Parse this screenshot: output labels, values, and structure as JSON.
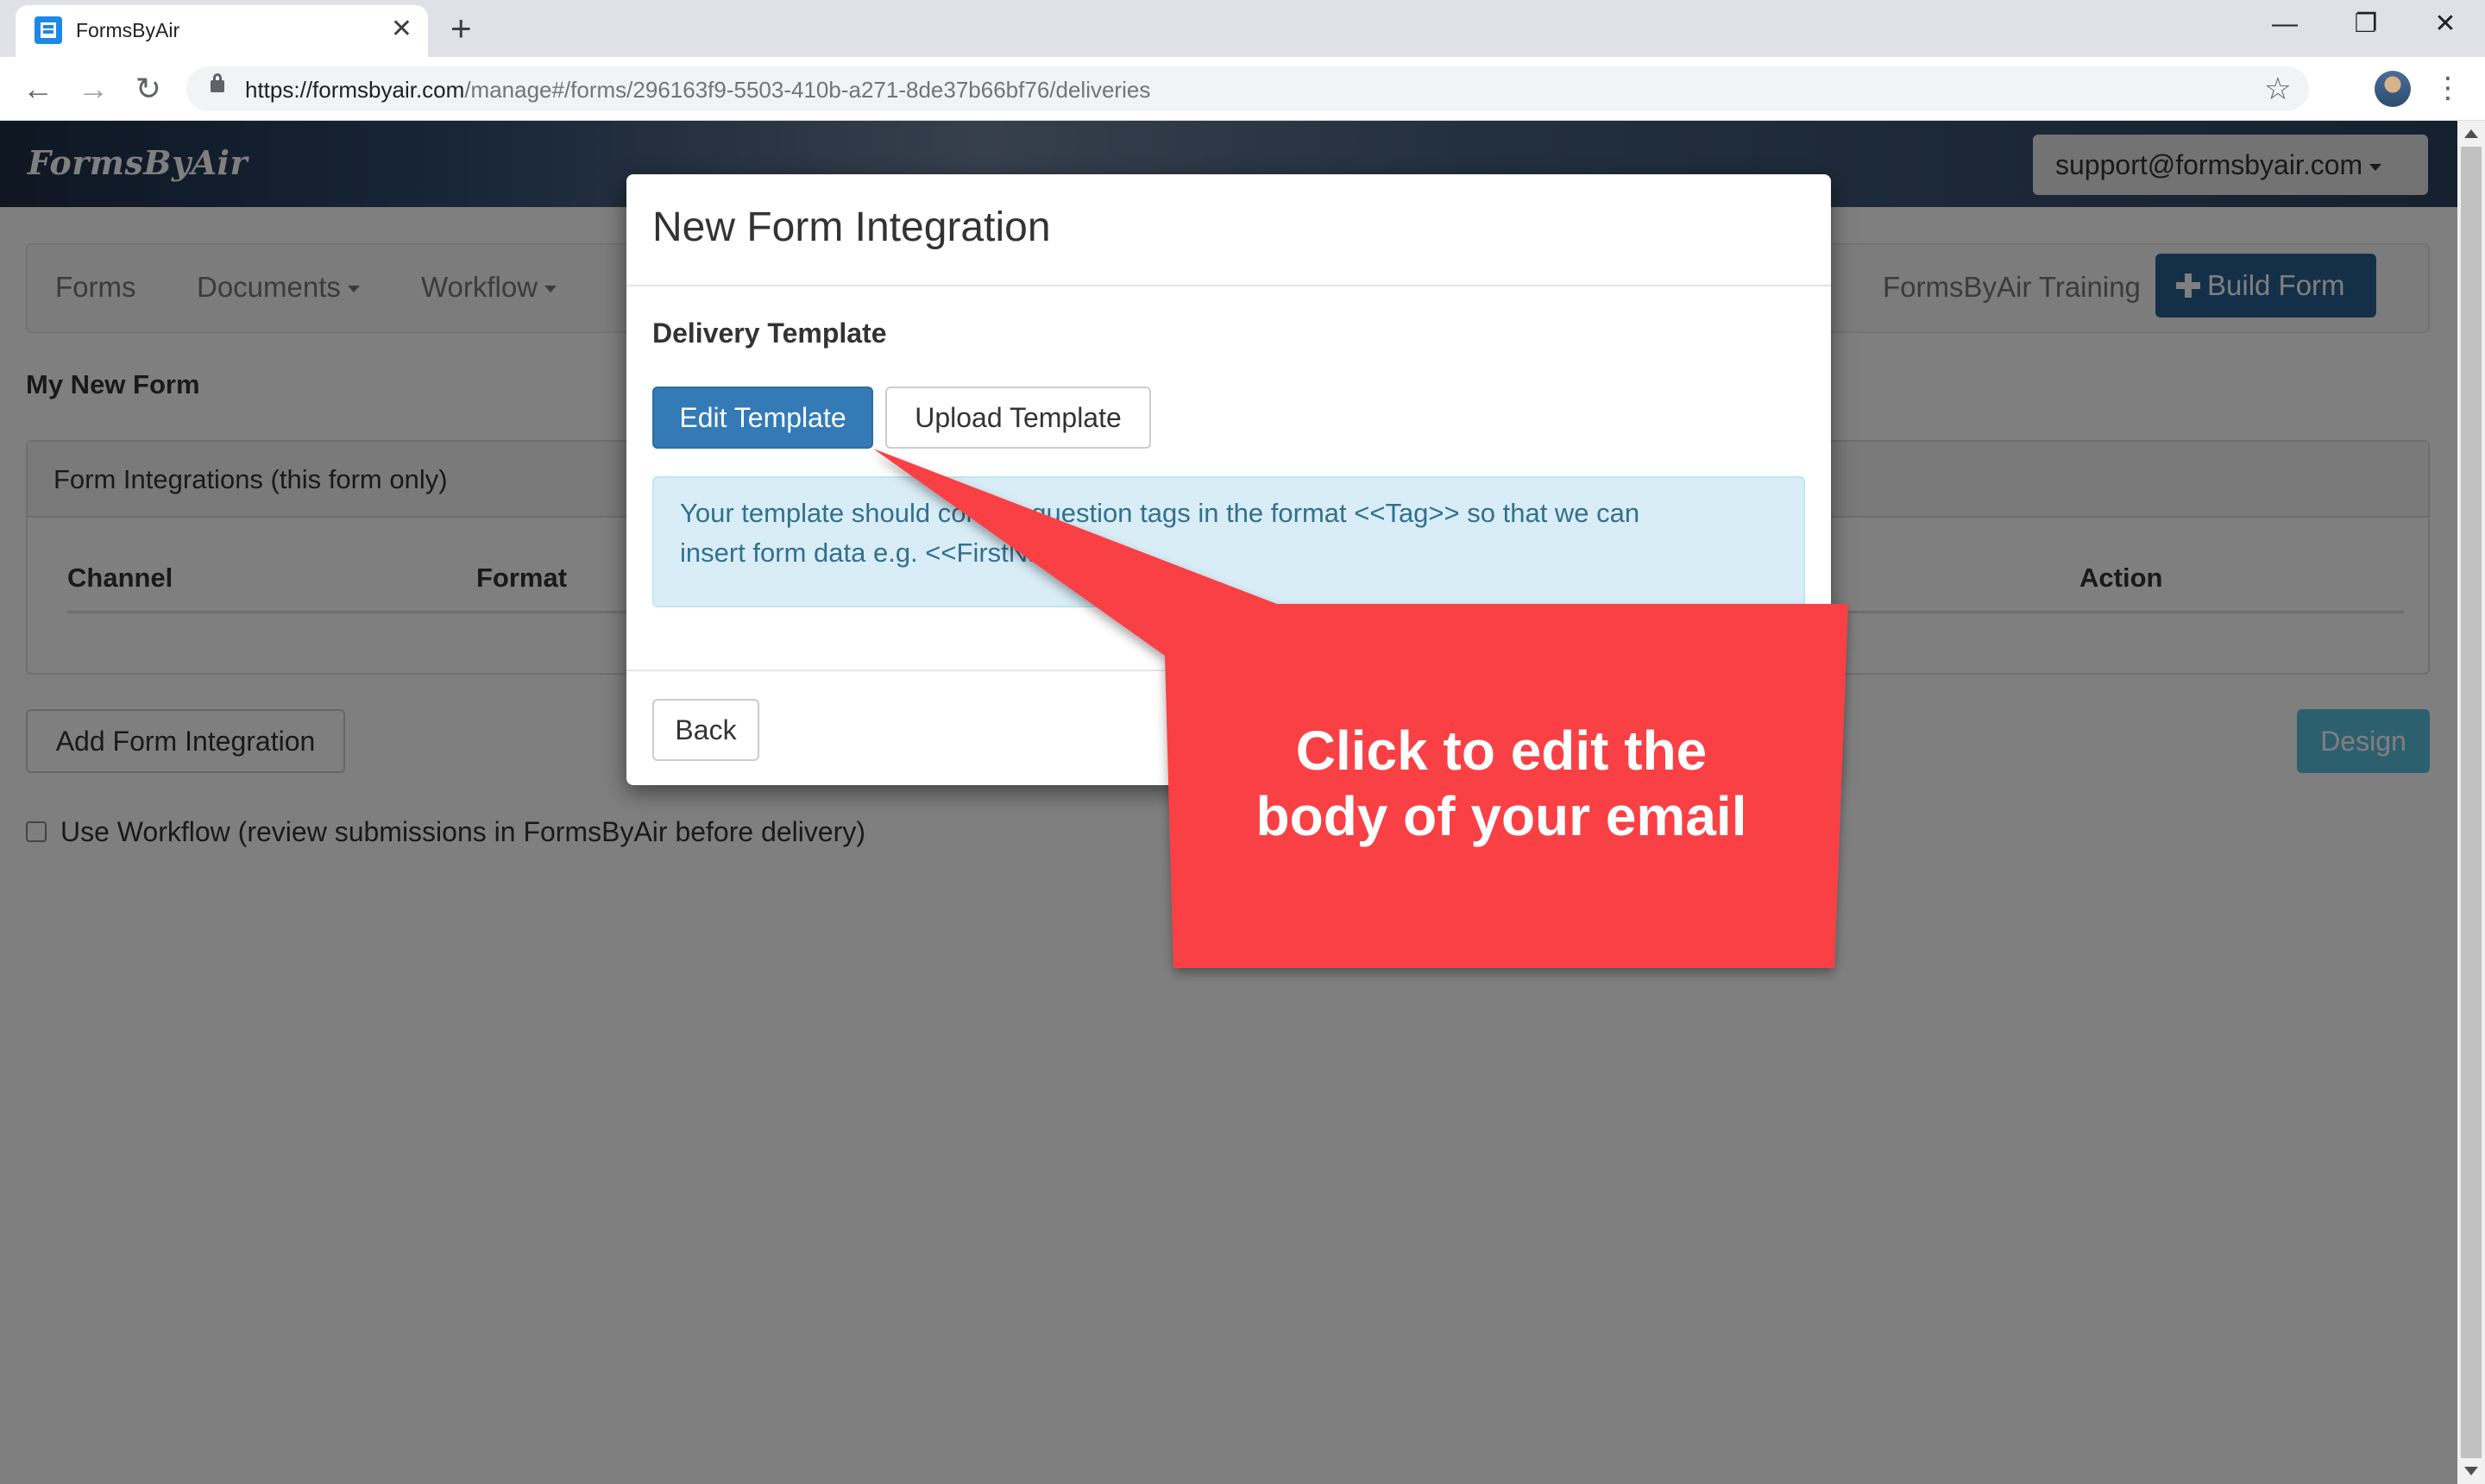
{
  "browser": {
    "tab_title": "FormsByAir",
    "tab_close": "✕",
    "new_tab": "+",
    "minimize": "—",
    "restore": "❐",
    "close": "✕",
    "back": "←",
    "forward": "→",
    "reload": "↻",
    "url_host": "https://formsbyair.com",
    "url_path": "/manage#/forms/296163f9-5503-410b-a271-8de37b66bf76/deliveries",
    "bookmark": "☆",
    "menu": "⋮"
  },
  "header": {
    "logo": "FormsByAir",
    "user": "support@formsbyair.com"
  },
  "nav": {
    "forms": "Forms",
    "documents": "Documents",
    "workflow": "Workflow",
    "training": "FormsByAir Training",
    "build_form": "Build Form"
  },
  "main": {
    "form_name": "My New Form",
    "panel_heading": "Form Integrations (this form only)",
    "columns": [
      "Channel",
      "Format",
      "Action"
    ],
    "add_button": "Add Form Integration",
    "design_button": "Design",
    "workflow_checkbox_label": "Use Workflow (review submissions in FormsByAir before delivery)",
    "workflow_checked": false
  },
  "modal": {
    "title": "New Form Integration",
    "section_label": "Delivery Template",
    "edit_button": "Edit Template",
    "upload_button": "Upload Template",
    "alert_line1": "Your template should contain question tags in the format <<Tag>> so that we can",
    "alert_line2": "insert form data e.g. <<FirstName>>",
    "back_button": "Back"
  },
  "callout": {
    "line1": "Click to edit the",
    "line2": "body of your email",
    "color": "#f94144"
  },
  "colors": {
    "primary": "#337ab7",
    "build_button": "#286090",
    "info": "#5bc0de",
    "alert_bg": "#d9edf7",
    "alert_text": "#31708f"
  }
}
